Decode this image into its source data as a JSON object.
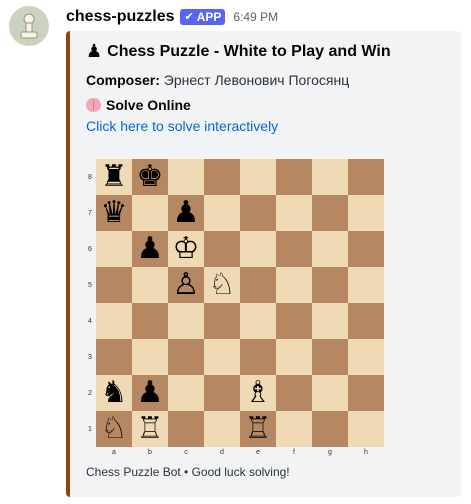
{
  "message": {
    "username": "chess-puzzles",
    "badge": "APP",
    "badge_check": "✔",
    "timestamp": "6:49 PM"
  },
  "embed": {
    "title_icon": "♟",
    "title": "Chess Puzzle - White to Play and Win",
    "composer_label": "Composer:",
    "composer_name": "Эрнест Левонович Погосянц",
    "solve_title": "Solve Online",
    "solve_link": "Click here to solve interactively",
    "footer": "Chess Puzzle Bot • Good luck solving!",
    "accent_color": "#8b4513"
  },
  "board": {
    "ranks": [
      "8",
      "7",
      "6",
      "5",
      "4",
      "3",
      "2",
      "1"
    ],
    "files": [
      "a",
      "b",
      "c",
      "d",
      "e",
      "f",
      "g",
      "h"
    ],
    "light_color": "#f0d9b5",
    "dark_color": "#b58863",
    "squares": [
      [
        "♜",
        "♚",
        "",
        "",
        "",
        "",
        "",
        ""
      ],
      [
        "♛",
        "",
        "♟",
        "",
        "",
        "",
        "",
        ""
      ],
      [
        "",
        "♟",
        "♔",
        "",
        "",
        "",
        "",
        ""
      ],
      [
        "",
        "",
        "♙",
        "♘",
        "",
        "",
        "",
        ""
      ],
      [
        "",
        "",
        "",
        "",
        "",
        "",
        "",
        ""
      ],
      [
        "",
        "",
        "",
        "",
        "",
        "",
        "",
        ""
      ],
      [
        "♞",
        "♟",
        "",
        "",
        "♗",
        "",
        "",
        ""
      ],
      [
        "♘",
        "♖",
        "",
        "",
        "♖",
        "",
        "",
        ""
      ]
    ]
  }
}
